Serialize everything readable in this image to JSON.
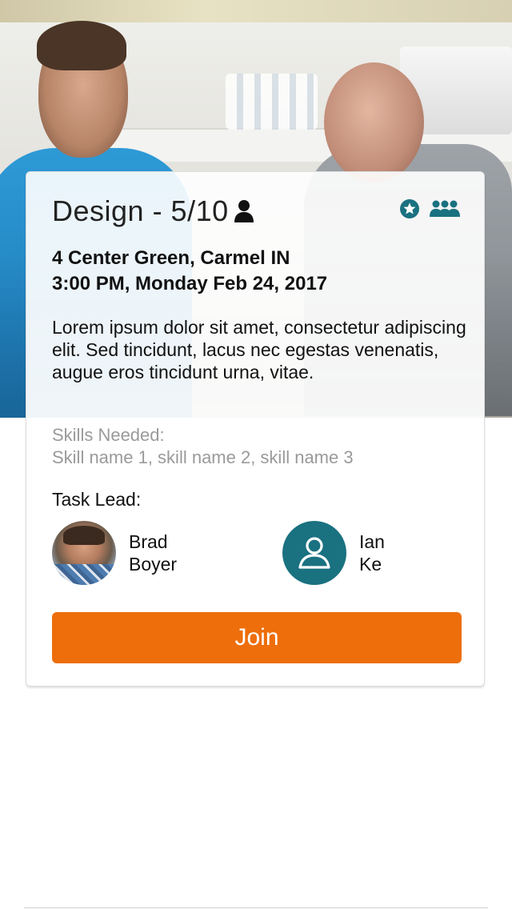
{
  "task": {
    "title": "Design - 5/10",
    "location": "4 Center Green, Carmel IN",
    "datetime": "3:00 PM, Monday Feb 24, 2017",
    "description": "Lorem ipsum dolor sit amet, consectetur adipiscing elit. Sed tincidunt, lacus nec egestas venenatis, augue eros tincidunt urna, vitae.",
    "skills_label": "Skills Needed:",
    "skills_value": "Skill name 1, skill name 2, skill name 3",
    "task_lead_label": "Task Lead:"
  },
  "leads": [
    {
      "first": "Brad",
      "last": "Boyer"
    },
    {
      "first": "Ian",
      "last": "Ke"
    }
  ],
  "actions": {
    "join_label": "Join"
  },
  "icons": {
    "title_icon": "person-icon",
    "favorite_icon": "star-badge-icon",
    "group_icon": "group-icon"
  },
  "colors": {
    "accent_teal": "#1a7180",
    "join_orange": "#ee6e0b"
  }
}
